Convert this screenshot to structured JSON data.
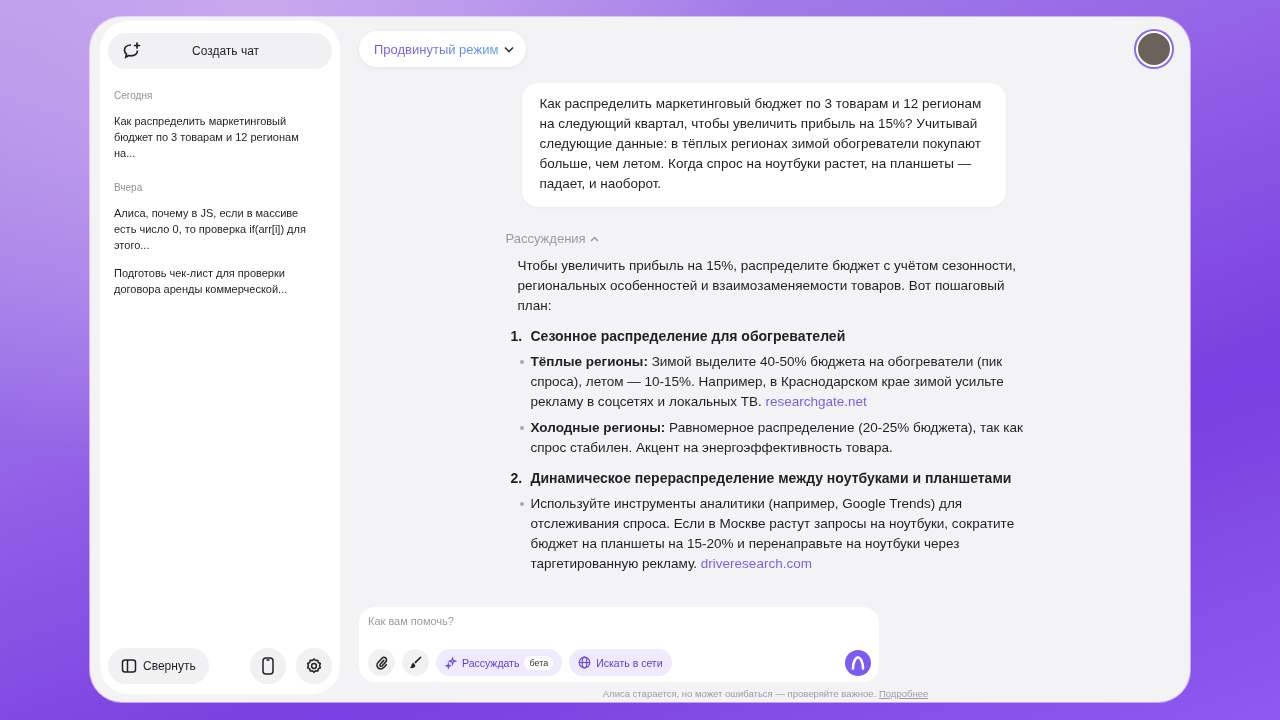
{
  "sidebar": {
    "new_chat": "Создать чат",
    "groups": [
      {
        "label": "Сегодня",
        "chats": [
          "Как распределить маркетинговый бюджет по 3 товарам и 12 регионам на..."
        ]
      },
      {
        "label": "Вчера",
        "chats": [
          "Алиса, почему в JS, если в массиве есть число 0, то проверка if(arr[i]) для этого...",
          "Подготовь чек-лист для проверки договора аренды коммерческой..."
        ]
      }
    ],
    "collapse_button": "Свернуть"
  },
  "header": {
    "mode": "Продвинутый режим"
  },
  "user_message": "Как распределить маркетинговый бюджет по 3 товарам и 12 регионам на следующий квартал, чтобы увеличить прибыль на 15%? Учитывай следующие данные: в тёплых регионах зимой обогреватели покупают больше, чем летом. Когда спрос на ноутбуки растет, на планшеты — падает, и наоборот.",
  "reasoning": {
    "label": "Рассуждения",
    "expanded": true
  },
  "answer": {
    "intro": "Чтобы увеличить прибыль на 15%, распределите бюджет с учётом сезонности, региональных особенностей и взаимозаменяемости товаров. Вот пошаговый план:",
    "sections": [
      {
        "number": "1.",
        "title": "Сезонное распределение для обогревателей",
        "bullets": [
          {
            "text": "**Тёплые регионы:** Зимой выделите 40-50% бюджета на обогреватели (пик спроса), летом — 10-15%. Например, в Краснодарском крае зимой усильте рекламу в соцсетях и локальных ТВ.",
            "link": "researchgate.net"
          },
          {
            "text": "**Холодные регионы:** Равномерное распределение (20-25% бюджета), так как спрос стабилен. Акцент на энергоэффективность товара."
          }
        ]
      },
      {
        "number": "2.",
        "title": "Динамическое перераспределение между ноутбуками и планшетами",
        "bullets": [
          {
            "text": "Используйте инструменты аналитики (например, Google Trends) для отслеживания спроса. Если в Москве растут запросы на ноутбуки, сократите бюджет на планшеты на 15-20% и перенаправьте на ноутбуки через таргетированную рекламу.",
            "link": "driveresearch.com"
          }
        ]
      }
    ]
  },
  "composer": {
    "placeholder": "Как вам помочь?",
    "toggles": [
      {
        "kind": "reasoning",
        "label": "Рассуждать",
        "badge": "бета",
        "on": true
      },
      {
        "kind": "web",
        "label": "Искать в сети",
        "on": true
      }
    ]
  },
  "disclaimer": {
    "text": "Алиса старается, но может ошибаться — проверяйте важное.",
    "link": "Подробнее"
  }
}
